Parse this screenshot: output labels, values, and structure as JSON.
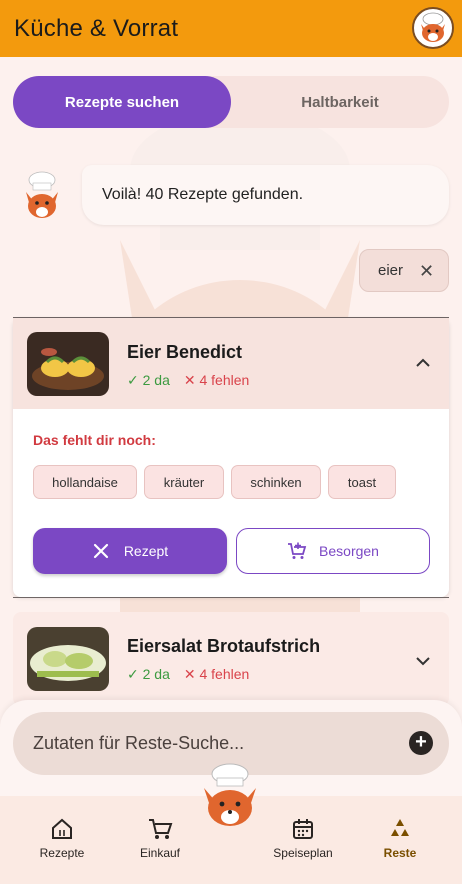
{
  "appbar": {
    "title": "Küche & Vorrat"
  },
  "tabs": [
    {
      "label": "Rezepte suchen",
      "active": true
    },
    {
      "label": "Haltbarkeit",
      "active": false
    }
  ],
  "chat": {
    "message": "Voilà! 40 Rezepte gefunden."
  },
  "filter": {
    "label": "eier"
  },
  "recipes": [
    {
      "title": "Eier Benedict",
      "have": "✓ 2 da",
      "missing": "✕ 4 fehlen",
      "expanded": true,
      "missing_title": "Das fehlt dir noch:",
      "missing_items": [
        "hollandaise",
        "kräuter",
        "schinken",
        "toast"
      ],
      "btn_recipe": "Rezept",
      "btn_buy": "Besorgen"
    },
    {
      "title": "Eiersalat Brotaufstrich",
      "have": "✓ 2 da",
      "missing": "✕ 4 fehlen",
      "expanded": false
    }
  ],
  "search": {
    "placeholder": "Zutaten für Reste-Suche..."
  },
  "nav": [
    {
      "label": "Rezepte",
      "icon": "home-icon"
    },
    {
      "label": "Einkauf",
      "icon": "cart-icon"
    },
    {
      "label": "Speiseplan",
      "icon": "calendar-icon"
    },
    {
      "label": "Reste",
      "icon": "recycle-icon",
      "active": true
    }
  ],
  "colors": {
    "appbar": "#f39a0d",
    "primary": "#7b48c4",
    "have": "#3c9a40",
    "missing": "#d9434b"
  }
}
